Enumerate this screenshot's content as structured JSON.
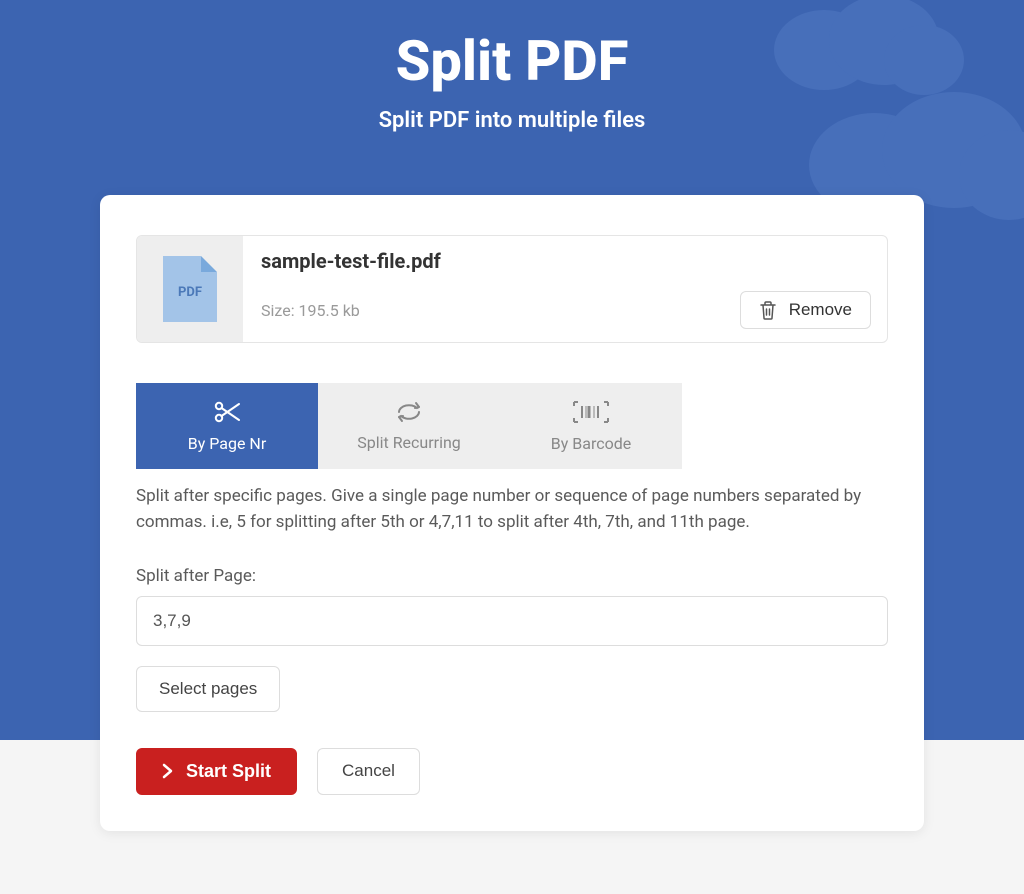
{
  "header": {
    "title": "Split PDF",
    "subtitle": "Split PDF into multiple files"
  },
  "file": {
    "icon_label": "PDF",
    "name": "sample-test-file.pdf",
    "size_text": "Size: 195.5 kb",
    "remove_label": "Remove"
  },
  "tabs": [
    {
      "label": "By Page Nr",
      "icon": "scissors-icon",
      "active": true
    },
    {
      "label": "Split Recurring",
      "icon": "recurring-icon",
      "active": false
    },
    {
      "label": "By Barcode",
      "icon": "barcode-icon",
      "active": false
    }
  ],
  "description": "Split after specific pages. Give a single page number or sequence of page numbers separated by commas. i.e, 5 for splitting after 5th or 4,7,11 to split after 4th, 7th, and 11th page.",
  "field": {
    "label": "Split after Page:",
    "value": "3,7,9"
  },
  "select_pages_label": "Select pages",
  "actions": {
    "start_label": "Start Split",
    "cancel_label": "Cancel"
  }
}
